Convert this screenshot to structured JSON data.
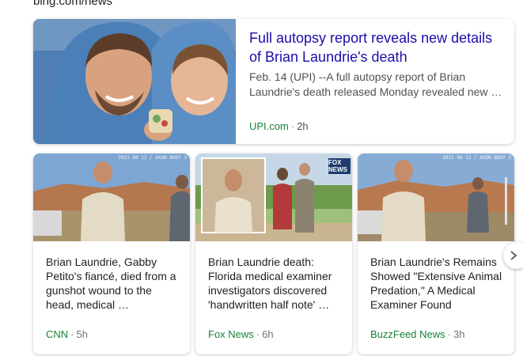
{
  "source_url": "bing.com/news",
  "featured": {
    "title_line1": "Full autopsy report reveals new details",
    "title_line2": "of Brian Laundrie's death",
    "snippet": "Feb. 14 (UPI) --A full autopsy report of Brian Laundrie's death released Monday revealed new …",
    "source": "UPI.com",
    "time": "2h"
  },
  "cards": [
    {
      "title": "Brian Laundrie, Gabby Petito's fiancé, died from a gunshot wound to the head, medical …",
      "source": "CNN",
      "time": "5h",
      "stamp": "2021 08 12 / AXON BODY 3"
    },
    {
      "title": "Brian Laundrie death: Florida medical examiner investigators discovered 'handwritten half note' …",
      "source": "Fox News",
      "time": "6h",
      "logo": "FOX NEWS"
    },
    {
      "title": "Brian Laundrie's Remains Showed \"Extensive Animal Predation,\" A Medical Examiner Found",
      "source": "BuzzFeed News",
      "time": "3h",
      "stamp": "2021 08 12 / AXON BODY 3"
    }
  ],
  "separator": "·",
  "colors": {
    "title_link": "#1a0dab",
    "source_green": "#188038",
    "snippet_gray": "#4d5156"
  }
}
